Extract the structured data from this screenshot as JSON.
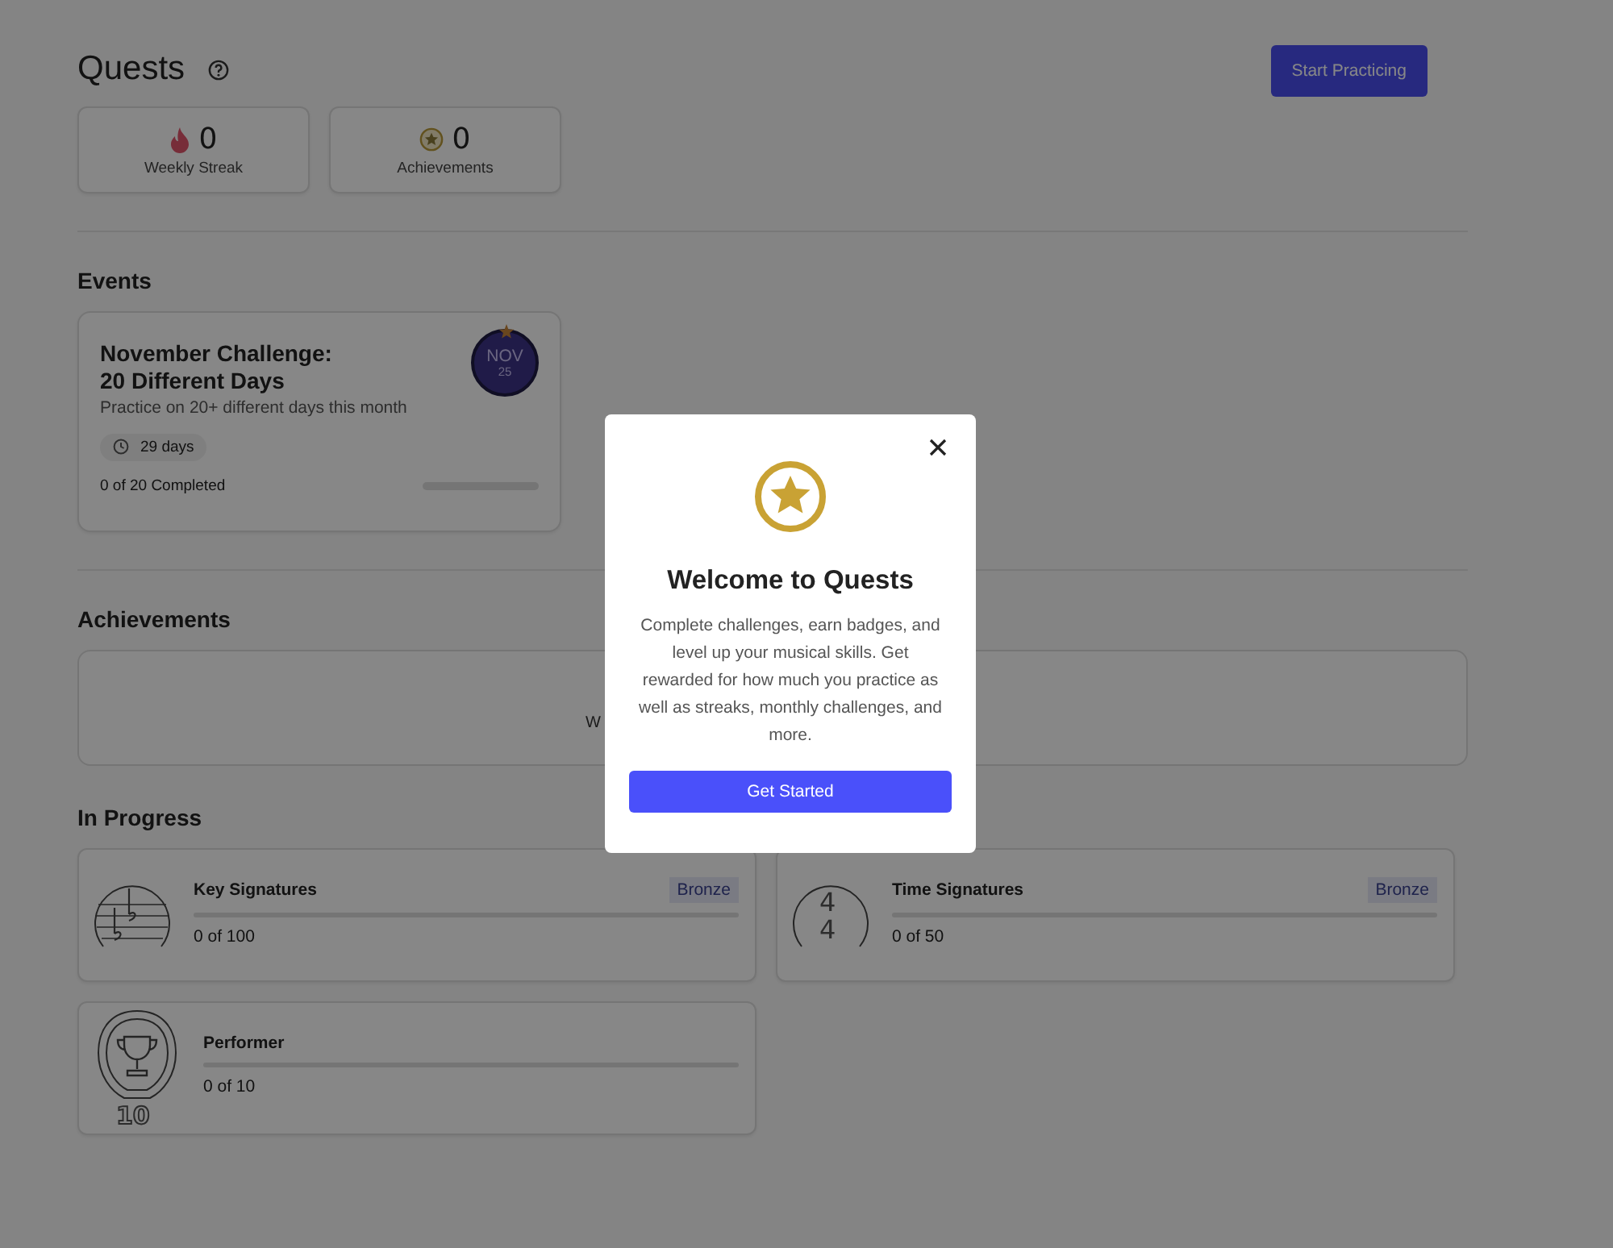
{
  "header": {
    "title": "Quests",
    "primary_button": "Start Practicing"
  },
  "stats": [
    {
      "kind": "streak",
      "value": "0",
      "label": "Weekly Streak"
    },
    {
      "kind": "achievements",
      "value": "0",
      "label": "Achievements"
    }
  ],
  "events": {
    "heading": "Events",
    "cards": [
      {
        "title_lines": [
          "November Challenge:",
          "20 Different Days"
        ],
        "description": "Practice on 20+ different days this month",
        "badge_month": "NOV",
        "badge_day": "25",
        "time_left": "29 days",
        "progress_text": "0 of 20 Completed",
        "level": 0
      }
    ]
  },
  "achievements": {
    "heading": "Achievements",
    "partial_text": "W"
  },
  "in_progress": {
    "heading": "In Progress",
    "quests": [
      {
        "kind": "key",
        "name": "Key Signatures",
        "tier": "Bronze",
        "progress_text": "0 of 100",
        "level": 0
      },
      {
        "kind": "time",
        "name": "Time Signatures",
        "tier": "Bronze",
        "progress_text": "0 of 50",
        "level": 0,
        "icon_digits": [
          "4",
          "4"
        ]
      },
      {
        "kind": "trophy",
        "name": "Performer",
        "progress_text": "0 of 10",
        "level": 0,
        "icon_digits": [
          "10"
        ]
      }
    ]
  },
  "modal": {
    "title": "Welcome to Quests",
    "body": "Complete challenges, earn badges, and level up your musical skills. Get rewarded for how much you practice as well as streaks, monthly challenges, and more.",
    "button": "Get Started"
  }
}
